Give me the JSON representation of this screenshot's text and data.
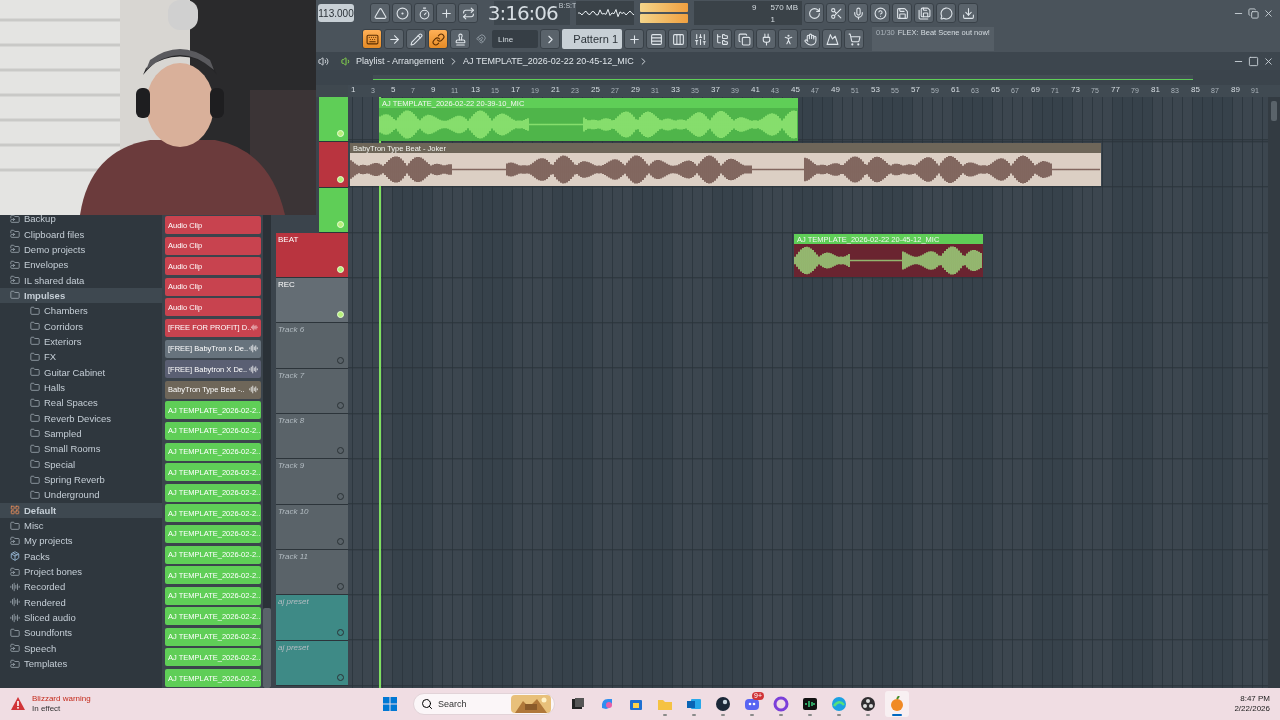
{
  "toolbar": {
    "tempo": "113.000",
    "time": "3:16:06",
    "time_format": "B:S:T",
    "cpu": "9",
    "memory": "570 MB",
    "polyphony": "1",
    "snap": "Line",
    "pattern": "Pattern 1",
    "hint_counter": "01/30",
    "hint": "FLEX: Beat Scene out now!",
    "tools": [
      {
        "on": true
      },
      {
        "on": false
      },
      {
        "on": false
      },
      {
        "on": true
      },
      {
        "on": false
      }
    ]
  },
  "browser": {
    "items": [
      {
        "label": "Backup",
        "kind": "shortcut",
        "selected": false
      },
      {
        "label": "Clipboard files",
        "kind": "shortcut",
        "selected": false
      },
      {
        "label": "Demo projects",
        "kind": "shortcut",
        "selected": false
      },
      {
        "label": "Envelopes",
        "kind": "shortcut",
        "selected": false
      },
      {
        "label": "IL shared data",
        "kind": "shortcut",
        "selected": false
      },
      {
        "label": "Impulses",
        "kind": "folder",
        "selected": true,
        "expanded": true,
        "children": [
          {
            "label": "Chambers",
            "kind": "folder",
            "selected": false
          },
          {
            "label": "Corridors",
            "kind": "folder",
            "selected": false
          },
          {
            "label": "Exteriors",
            "kind": "folder",
            "selected": false
          },
          {
            "label": "FX",
            "kind": "folder",
            "selected": false
          },
          {
            "label": "Guitar Cabinet",
            "kind": "folder",
            "selected": false
          },
          {
            "label": "Halls",
            "kind": "folder",
            "selected": false
          },
          {
            "label": "Real Spaces",
            "kind": "folder",
            "selected": false
          },
          {
            "label": "Reverb Devices",
            "kind": "folder",
            "selected": false
          },
          {
            "label": "Sampled",
            "kind": "folder",
            "selected": false
          },
          {
            "label": "Small Rooms",
            "kind": "folder",
            "selected": false
          },
          {
            "label": "Special",
            "kind": "folder",
            "selected": false
          },
          {
            "label": "Spring Reverb",
            "kind": "folder",
            "selected": false
          },
          {
            "label": "Underground",
            "kind": "folder",
            "selected": false
          }
        ]
      },
      {
        "label": "Default",
        "kind": "default",
        "selected": true
      },
      {
        "label": "Misc",
        "kind": "folder",
        "selected": false
      },
      {
        "label": "My projects",
        "kind": "shortcut",
        "selected": false
      },
      {
        "label": "Packs",
        "kind": "packs",
        "selected": false
      },
      {
        "label": "Project bones",
        "kind": "shortcut",
        "selected": false
      },
      {
        "label": "Recorded",
        "kind": "audio",
        "selected": false
      },
      {
        "label": "Rendered",
        "kind": "audio",
        "selected": false
      },
      {
        "label": "Sliced audio",
        "kind": "audio",
        "selected": false
      },
      {
        "label": "Soundfonts",
        "kind": "folder",
        "selected": false
      },
      {
        "label": "Speech",
        "kind": "shortcut",
        "selected": false
      },
      {
        "label": "Templates",
        "kind": "shortcut",
        "selected": false
      }
    ]
  },
  "clip_list": [
    {
      "label": "Audio Clip",
      "color": "#c8434f",
      "stretch_icon": false
    },
    {
      "label": "Audio Clip",
      "color": "#c8434f",
      "stretch_icon": false
    },
    {
      "label": "Audio Clip",
      "color": "#c8434f",
      "stretch_icon": false
    },
    {
      "label": "Audio Clip",
      "color": "#c8434f",
      "stretch_icon": false
    },
    {
      "label": "Audio Clip",
      "color": "#c8434f",
      "stretch_icon": false
    },
    {
      "label": "[FREE FOR PROFIT] D..",
      "color": "#c8434f",
      "stretch_icon": true
    },
    {
      "label": "[FREE] BabyTron x De..",
      "color": "#67737d",
      "stretch_icon": true
    },
    {
      "label": "[FREE] Babytron X De..",
      "color": "#5a5f73",
      "stretch_icon": true
    },
    {
      "label": "BabyTron Type Beat -..",
      "color": "#6e6659",
      "stretch_icon": true
    },
    {
      "label": "AJ TEMPLATE_2026-02-2..",
      "color": "#5fce57",
      "stretch_icon": false
    },
    {
      "label": "AJ TEMPLATE_2026-02-2..",
      "color": "#5fce57",
      "stretch_icon": false
    },
    {
      "label": "AJ TEMPLATE_2026-02-2..",
      "color": "#5fce57",
      "stretch_icon": false
    },
    {
      "label": "AJ TEMPLATE_2026-02-2..",
      "color": "#5fce57",
      "stretch_icon": false
    },
    {
      "label": "AJ TEMPLATE_2026-02-2..",
      "color": "#5fce57",
      "stretch_icon": false
    },
    {
      "label": "AJ TEMPLATE_2026-02-2..",
      "color": "#5fce57",
      "stretch_icon": false
    },
    {
      "label": "AJ TEMPLATE_2026-02-2..",
      "color": "#5fce57",
      "stretch_icon": false
    },
    {
      "label": "AJ TEMPLATE_2026-02-2..",
      "color": "#5fce57",
      "stretch_icon": false
    },
    {
      "label": "AJ TEMPLATE_2026-02-2..",
      "color": "#5fce57",
      "stretch_icon": false
    },
    {
      "label": "AJ TEMPLATE_2026-02-2..",
      "color": "#5fce57",
      "stretch_icon": false
    },
    {
      "label": "AJ TEMPLATE_2026-02-2..",
      "color": "#5fce57",
      "stretch_icon": false
    },
    {
      "label": "AJ TEMPLATE_2026-02-2..",
      "color": "#5fce57",
      "stretch_icon": false
    },
    {
      "label": "AJ TEMPLATE_2026-02-2..",
      "color": "#5fce57",
      "stretch_icon": false
    },
    {
      "label": "AJ TEMPLATE_2026-02-2..",
      "color": "#5fce57",
      "stretch_icon": false
    }
  ],
  "playlist": {
    "title": "Playlist - Arrangement",
    "path": "AJ TEMPLATE_2026-02-22 20-45-12_MIC",
    "ruler": [
      "1",
      "3",
      "5",
      "7",
      "9",
      "11",
      "13",
      "15",
      "17",
      "19",
      "21",
      "23",
      "25",
      "27",
      "29",
      "31",
      "33",
      "35",
      "37",
      "39",
      "41",
      "43",
      "45",
      "47",
      "49",
      "51",
      "53",
      "55",
      "57",
      "59",
      "61",
      "63",
      "65",
      "67",
      "69",
      "71",
      "73",
      "75",
      "77",
      "79",
      "81",
      "83",
      "85",
      "87",
      "89",
      "91"
    ],
    "tracks": [
      {
        "color": "#5fce57",
        "lit": true
      },
      {
        "color": "#b9343f",
        "lit": true
      },
      {
        "color": "#5fce57",
        "lit": true
      },
      {
        "label": "BEAT",
        "color": "#b9343f",
        "lit": true,
        "dim": false
      },
      {
        "label": "REC",
        "color": "#646d74",
        "lit": true,
        "dim": false
      },
      {
        "label": "Track 6",
        "color": "#5a6369",
        "lit": false,
        "dim": true
      },
      {
        "label": "Track 7",
        "color": "#5a6369",
        "lit": false,
        "dim": true
      },
      {
        "label": "Track 8",
        "color": "#5a6369",
        "lit": false,
        "dim": true
      },
      {
        "label": "Track 9",
        "color": "#5a6369",
        "lit": false,
        "dim": true
      },
      {
        "label": "Track 10",
        "color": "#5a6369",
        "lit": false,
        "dim": true
      },
      {
        "label": "Track 11",
        "color": "#5a6369",
        "lit": false,
        "dim": true
      },
      {
        "label": "aj preset",
        "color": "#3e8a86",
        "lit": false,
        "dim": true
      },
      {
        "label": "aj preset",
        "color": "#3e8a86",
        "lit": false,
        "dim": true
      }
    ],
    "clips": [
      {
        "name": "AJ TEMPLATE_2026-02-22 20-39-10_MIC",
        "kind": "mic"
      },
      {
        "name": "BabyTron Type Beat - Joker",
        "kind": "beat"
      },
      {
        "name": "AJ TEMPLATE_2026-02-22 20-45-12_MIC",
        "kind": "recording"
      }
    ]
  },
  "taskbar": {
    "weather_title": "Blizzard warning",
    "weather_status": "In effect",
    "search_placeholder": "Search",
    "badge": "9+",
    "time": "8:47 PM",
    "date": "2/22/2026",
    "apps": [
      {
        "running": false,
        "active": false
      },
      {
        "running": false,
        "active": false
      },
      {
        "running": false,
        "active": false
      },
      {
        "running": true,
        "active": false
      },
      {
        "running": true,
        "active": false
      },
      {
        "running": true,
        "active": false
      },
      {
        "running": true,
        "active": false
      },
      {
        "running": true,
        "active": false
      },
      {
        "running": true,
        "active": false
      },
      {
        "running": true,
        "active": false
      },
      {
        "running": true,
        "active": false
      },
      {
        "running": true,
        "active": true
      }
    ]
  }
}
